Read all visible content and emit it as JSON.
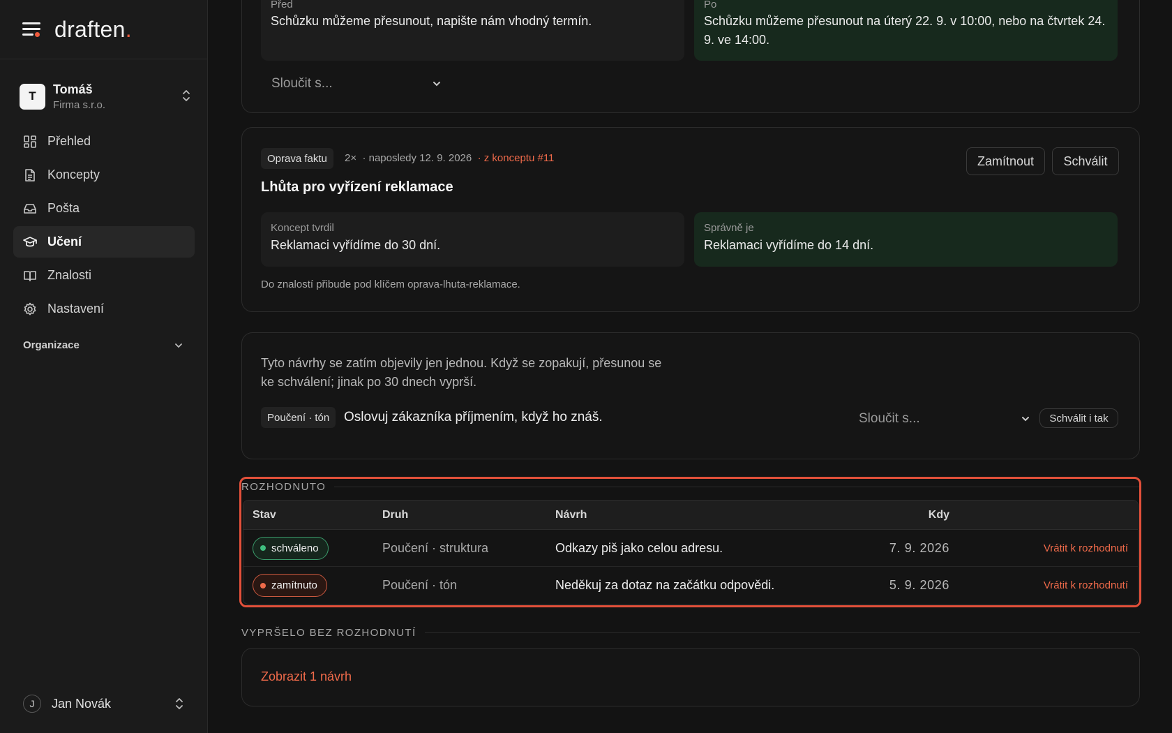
{
  "app": {
    "logo_text": "draften",
    "logo_dot": "."
  },
  "account": {
    "initial": "T",
    "name": "Tomáš",
    "org": "Firma s.r.o."
  },
  "nav": [
    {
      "label": "Přehled",
      "icon": "grid-icon"
    },
    {
      "label": "Koncepty",
      "icon": "document-icon"
    },
    {
      "label": "Pošta",
      "icon": "inbox-icon"
    },
    {
      "label": "Učení",
      "icon": "graduation-cap-icon",
      "active": true
    },
    {
      "label": "Znalosti",
      "icon": "book-icon"
    },
    {
      "label": "Nastavení",
      "icon": "gear-icon"
    }
  ],
  "organization_label": "Organizace",
  "user": {
    "initial": "J",
    "name": "Jan Novák"
  },
  "card1": {
    "before_label": "Před",
    "before_text": "Schůzku můžeme přesunout, napište nám vhodný termín.",
    "after_label": "Po",
    "after_text": "Schůzku můžeme přesunout na úterý 22. 9. v 10:00, nebo na čtvrtek 24. 9. ve 14:00.",
    "merge_placeholder": "Sloučit s..."
  },
  "card2": {
    "chip": "Oprava faktu",
    "count": "2×",
    "last_seen": "· naposledy 12. 9. 2026",
    "source": "· z konceptu #11",
    "reject_label": "Zamítnout",
    "approve_label": "Schválit",
    "title": "Lhůta pro vyřízení reklamace",
    "claimed_label": "Koncept tvrdil",
    "claimed_text": "Reklamaci vyřídíme do 30 dní.",
    "correct_label": "Správně je",
    "correct_text": "Reklamaci vyřídíme do 14 dní.",
    "note": "Do znalostí přibude pod klíčem oprava-lhuta-reklamace."
  },
  "card3": {
    "intro_line1": "Tyto návrhy se zatím objevily jen jednou. Když se zopakují, přesunou se",
    "intro_line2": "ke schválení; jinak po 30 dnech vyprší.",
    "chip": "Poučení · tón",
    "text": "Oslovuj zákazníka příjmením, když ho znáš.",
    "merge_placeholder": "Sloučit s...",
    "approve_anyway_label": "Schválit i tak"
  },
  "decided": {
    "heading": "ROZHODNUTO",
    "columns": {
      "status": "Stav",
      "kind": "Druh",
      "proposal": "Návrh",
      "when": "Kdy"
    },
    "rows": [
      {
        "status": "schváleno",
        "status_type": "approved",
        "kind": "Poučení · struktura",
        "proposal": "Odkazy piš jako celou adresu.",
        "when": "7. 9. 2026",
        "action": "Vrátit k rozhodnutí"
      },
      {
        "status": "zamítnuto",
        "status_type": "rejected",
        "kind": "Poučení · tón",
        "proposal": "Neděkuj za dotaz na začátku odpovědi.",
        "when": "5. 9. 2026",
        "action": "Vrátit k rozhodnutí"
      }
    ]
  },
  "expired": {
    "heading": "VYPRŠELO BEZ ROZHODNUTÍ",
    "show_link": "Zobrazit 1 návrh"
  },
  "colors": {
    "accent": "#ef6a4a",
    "approved": "#3fbf7f",
    "highlight": "#e2503a"
  }
}
